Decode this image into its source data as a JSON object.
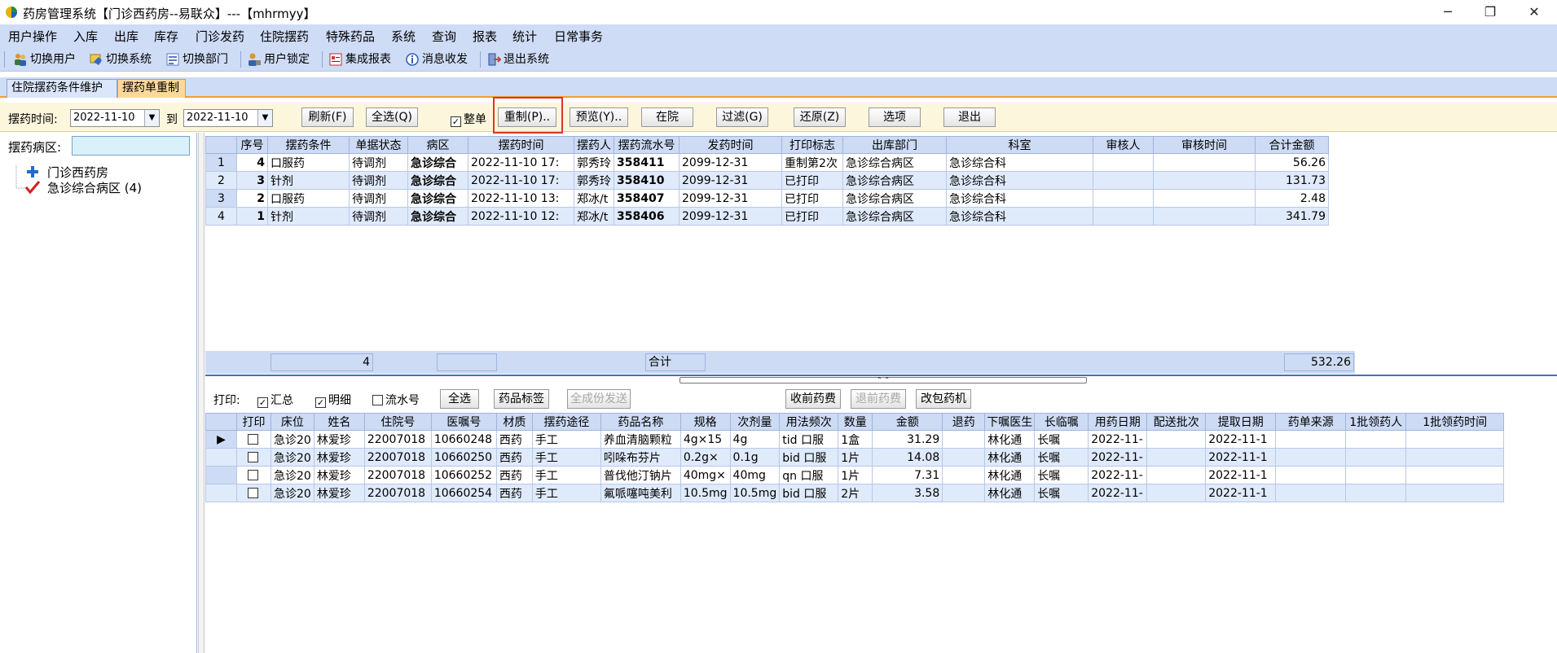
{
  "window": {
    "title": "药房管理系统【门诊西药房--易联众】---【mhrmyy】",
    "min_glyph": "─",
    "restore_glyph": "❐",
    "close_glyph": "✕"
  },
  "menu": [
    "用户操作",
    "入库",
    "出库",
    "库存",
    "门诊发药",
    "住院摆药",
    "特殊药品",
    "系统",
    "查询",
    "报表",
    "统计",
    "日常事务"
  ],
  "toolbar": [
    {
      "label": "切换用户",
      "icon": "users-icon"
    },
    {
      "label": "切换系统",
      "icon": "switch-system-icon"
    },
    {
      "label": "切换部门",
      "icon": "department-icon"
    },
    {
      "label": "用户锁定",
      "icon": "user-lock-icon"
    },
    {
      "label": "集成报表",
      "icon": "report-icon"
    },
    {
      "label": "消息收发",
      "icon": "message-icon"
    },
    {
      "label": "退出系统",
      "icon": "exit-icon"
    }
  ],
  "tabs": [
    {
      "label": "住院摆药条件维护",
      "active": false
    },
    {
      "label": "摆药单重制",
      "active": true
    }
  ],
  "filter": {
    "time_label": "摆药时间:",
    "date_from": "2022-11-10",
    "to_label": "到",
    "date_to": "2022-11-10",
    "refresh": "刷新(F)",
    "select_all": "全选(Q)",
    "whole_label": "整单",
    "whole_checked": true,
    "remake": "重制(P)..",
    "preview": "预览(Y)..",
    "in_hospital": "在院",
    "filter_btn": "过滤(G)",
    "restore": "还原(Z)",
    "options": "选项",
    "exit": "退出"
  },
  "left": {
    "ward_label": "摆药病区:",
    "ward_value": "",
    "tree_root": "门诊西药房",
    "tree_child": "急诊综合病区 (4)"
  },
  "top_grid": {
    "columns": [
      "序号",
      "摆药条件",
      "单据状态",
      "病区",
      "摆药时间",
      "摆药人",
      "摆药流水号",
      "发药时间",
      "打印标志",
      "出库部门",
      "科室",
      "审核人",
      "审核时间",
      "合计金额"
    ],
    "rows": [
      [
        "4",
        "口服药",
        "待调剂",
        "急诊综合",
        "2022-11-10 17:",
        "郭秀玲",
        "358411",
        "2099-12-31",
        "重制第2次",
        "急诊综合病区",
        "急诊综合科",
        "",
        "",
        "56.26"
      ],
      [
        "3",
        "针剂",
        "待调剂",
        "急诊综合",
        "2022-11-10 17:",
        "郭秀玲",
        "358410",
        "2099-12-31",
        "已打印",
        "急诊综合病区",
        "急诊综合科",
        "",
        "",
        "131.73"
      ],
      [
        "2",
        "口服药",
        "待调剂",
        "急诊综合",
        "2022-11-10 13:",
        "郑冰/t",
        "358407",
        "2099-12-31",
        "已打印",
        "急诊综合病区",
        "急诊综合科",
        "",
        "",
        "2.48"
      ],
      [
        "1",
        "针剂",
        "待调剂",
        "急诊综合",
        "2022-11-10 12:",
        "郑冰/t",
        "358406",
        "2099-12-31",
        "已打印",
        "急诊综合病区",
        "急诊综合科",
        "",
        "",
        "341.79"
      ]
    ],
    "summary_count": "4",
    "summary_label": "合计",
    "summary_total": "532.26"
  },
  "print_bar": {
    "label": "打印:",
    "summary": "汇总",
    "summary_checked": true,
    "detail": "明细",
    "detail_checked": true,
    "serial": "流水号",
    "serial_checked": false,
    "select_all": "全选",
    "drug_label": "药品标签",
    "send_all": "全成份发送",
    "charge_before": "收前药费",
    "refund_before": "退前药费",
    "change_machine": "改包药机"
  },
  "bottom_grid": {
    "columns": [
      "打印",
      "床位",
      "姓名",
      "住院号",
      "医嘱号",
      "材质",
      "摆药途径",
      "药品名称",
      "规格",
      "次剂量",
      "用法频次",
      "数量",
      "金额",
      "退药",
      "下嘱医生",
      "长临嘱",
      "用药日期",
      "配送批次",
      "提取日期",
      "药单来源",
      "1批领药人",
      "1批领药时间"
    ],
    "rows": [
      [
        "",
        "急诊20",
        "林爱珍",
        "22007018",
        "10660248",
        "西药",
        "手工",
        "养血清脑颗粒",
        "4g×15",
        "4g",
        "tid 口服",
        "1盒",
        "31.29",
        "",
        "林化通",
        "长嘱",
        "2022-11-",
        "",
        "2022-11-1",
        "",
        "",
        ""
      ],
      [
        "",
        "急诊20",
        "林爱珍",
        "22007018",
        "10660250",
        "西药",
        "手工",
        "吲哚布芬片",
        "0.2g×",
        "0.1g",
        "bid 口服",
        "1片",
        "14.08",
        "",
        "林化通",
        "长嘱",
        "2022-11-",
        "",
        "2022-11-1",
        "",
        "",
        ""
      ],
      [
        "",
        "急诊20",
        "林爱珍",
        "22007018",
        "10660252",
        "西药",
        "手工",
        "普伐他汀钠片",
        "40mg×",
        "40mg",
        "qn 口服",
        "1片",
        "7.31",
        "",
        "林化通",
        "长嘱",
        "2022-11-",
        "",
        "2022-11-1",
        "",
        "",
        ""
      ],
      [
        "",
        "急诊20",
        "林爱珍",
        "22007018",
        "10660254",
        "西药",
        "手工",
        "氟哌噻吨美利",
        "10.5mg",
        "10.5mg",
        "bid 口服",
        "2片",
        "3.58",
        "",
        "林化通",
        "长嘱",
        "2022-11-",
        "",
        "2022-11-1",
        "",
        "",
        ""
      ]
    ],
    "current_row_marker": "▶"
  }
}
